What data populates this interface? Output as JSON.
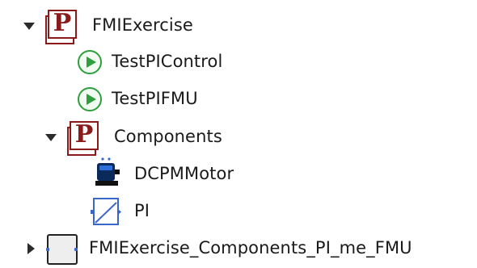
{
  "tree": {
    "root": {
      "label": "FMIExercise",
      "expanded": true,
      "icon": "package-icon"
    },
    "children": [
      {
        "label": "TestPIControl",
        "icon": "play-icon"
      },
      {
        "label": "TestPIFMU",
        "icon": "play-icon"
      },
      {
        "label": "Components",
        "expanded": true,
        "icon": "package-icon",
        "children": [
          {
            "label": "DCPMMotor",
            "icon": "motor-icon"
          },
          {
            "label": "PI",
            "icon": "pi-block-icon"
          }
        ]
      }
    ],
    "sibling": {
      "label": "FMIExercise_Components_PI_me_FMU",
      "expanded": false,
      "icon": "fmu-block-icon"
    }
  },
  "colors": {
    "package": "#8b1a1a",
    "play": "#2e9e3e",
    "connector": "#3b66c9"
  }
}
